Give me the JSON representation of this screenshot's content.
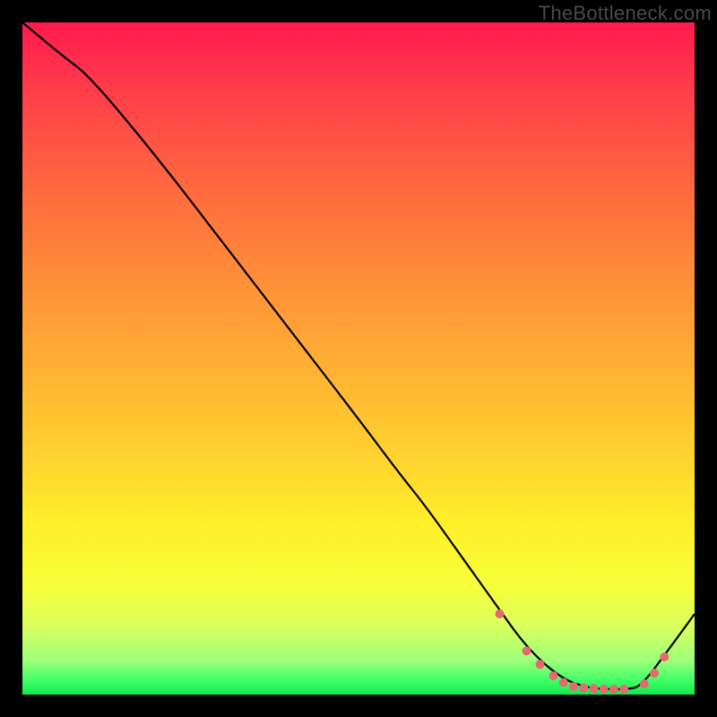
{
  "watermark": "TheBottleneck.com",
  "colors": {
    "dot": "#e46a6f",
    "line": "#000000"
  },
  "chart_data": {
    "type": "line",
    "title": "",
    "xlabel": "",
    "ylabel": "",
    "xlim": [
      0,
      100
    ],
    "ylim": [
      0,
      100
    ],
    "series": [
      {
        "name": "curve",
        "x": [
          0,
          6,
          10,
          20,
          30,
          40,
          50,
          56,
          60,
          65,
          70,
          75,
          80,
          84,
          87,
          90,
          92,
          96,
          100
        ],
        "y": [
          100,
          95,
          92,
          80,
          67,
          54,
          41,
          33,
          28,
          21,
          14,
          7,
          2.5,
          1.0,
          0.8,
          0.8,
          1.2,
          6.5,
          12
        ]
      }
    ],
    "markers": {
      "name": "highlighted-points",
      "x": [
        71,
        75,
        77,
        79,
        80.5,
        82,
        83.5,
        85,
        86.5,
        88,
        89.5,
        92.5,
        94,
        95.5
      ],
      "y": [
        12,
        6.5,
        4.5,
        2.8,
        1.8,
        1.2,
        1.0,
        0.9,
        0.8,
        0.8,
        0.8,
        1.6,
        3.2,
        5.6
      ]
    }
  }
}
